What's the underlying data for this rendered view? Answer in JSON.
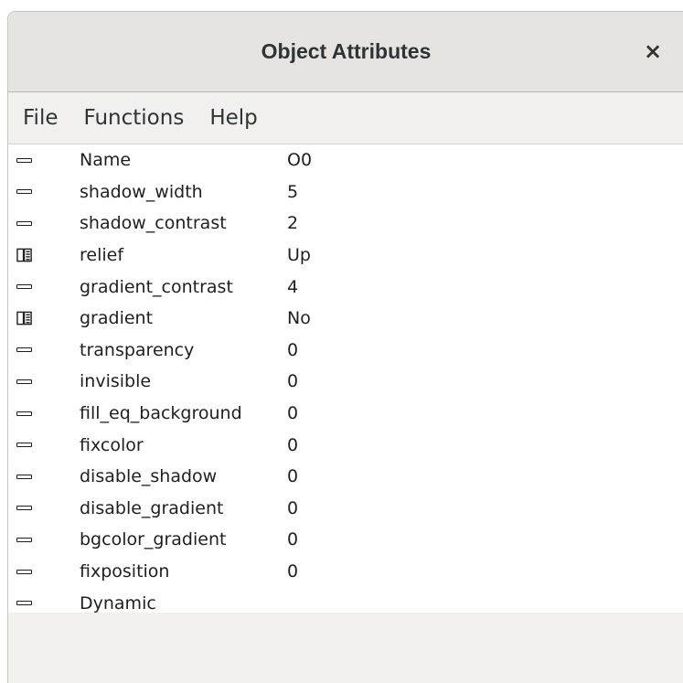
{
  "window": {
    "title": "Object Attributes",
    "close_glyph": "×"
  },
  "menu": [
    "File",
    "Functions",
    "Help"
  ],
  "attributes": [
    {
      "name": "Name",
      "value": "O0",
      "icon": "dash-icon"
    },
    {
      "name": "shadow_width",
      "value": "5",
      "icon": "dash-icon"
    },
    {
      "name": "shadow_contrast",
      "value": "2",
      "icon": "dash-icon"
    },
    {
      "name": "relief",
      "value": "Up",
      "icon": "book-icon"
    },
    {
      "name": "gradient_contrast",
      "value": "4",
      "icon": "dash-icon"
    },
    {
      "name": "gradient",
      "value": "No",
      "icon": "book-icon"
    },
    {
      "name": "transparency",
      "value": "0",
      "icon": "dash-icon"
    },
    {
      "name": "invisible",
      "value": "0",
      "icon": "dash-icon"
    },
    {
      "name": "fill_eq_background",
      "value": "0",
      "icon": "dash-icon"
    },
    {
      "name": "fixcolor",
      "value": "0",
      "icon": "dash-icon"
    },
    {
      "name": "disable_shadow",
      "value": "0",
      "icon": "dash-icon"
    },
    {
      "name": "disable_gradient",
      "value": "0",
      "icon": "dash-icon"
    },
    {
      "name": "bgcolor_gradient",
      "value": "0",
      "icon": "dash-icon"
    },
    {
      "name": "fixposition",
      "value": "0",
      "icon": "dash-icon"
    },
    {
      "name": "Dynamic",
      "value": "",
      "icon": "dash-icon"
    }
  ]
}
